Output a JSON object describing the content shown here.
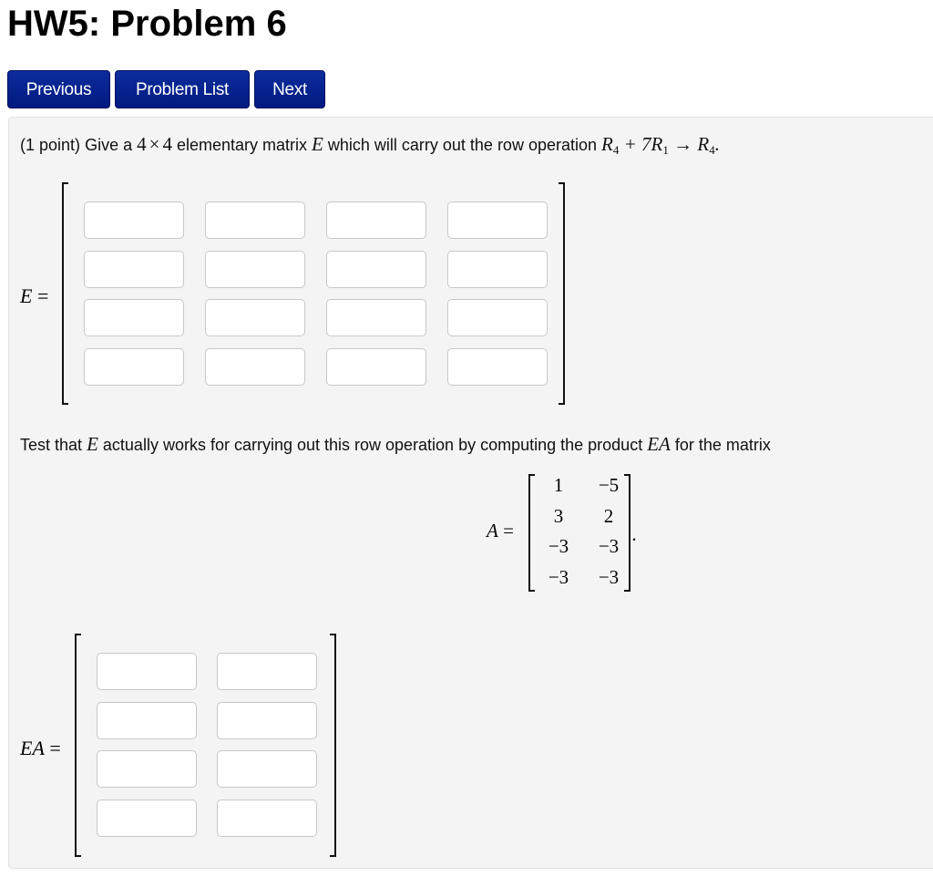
{
  "page": {
    "title": "HW5: Problem 6"
  },
  "nav": {
    "previous": "Previous",
    "problem_list": "Problem List",
    "next": "Next"
  },
  "problem": {
    "points": "(1 point)",
    "intro_text": "Give a",
    "dims_a": "4",
    "times": "×",
    "dims_b": "4",
    "intro_text2": "elementary matrix",
    "matrix_name": "E",
    "intro_text3": "which will carry out the row operation",
    "op": {
      "r4": "R",
      "r4_sub": "4",
      "plus": "+ 7",
      "r1": "R",
      "r1_sub": "1",
      "arrow": "→",
      "r4b": "R",
      "r4b_sub": "4",
      "period": "."
    },
    "e_label": "E =",
    "e_matrix": {
      "rows": 4,
      "cols": 4,
      "values": [
        [
          "",
          "",
          "",
          ""
        ],
        [
          "",
          "",
          "",
          ""
        ],
        [
          "",
          "",
          "",
          ""
        ],
        [
          "",
          "",
          "",
          ""
        ]
      ]
    },
    "test_text1": "Test that",
    "test_E": "E",
    "test_text2": "actually works for carrying out this row operation by computing the product",
    "test_EA": "EA",
    "test_text3": "for the matrix",
    "a_label": "A =",
    "a_matrix": [
      [
        "1",
        "−5"
      ],
      [
        "3",
        "2"
      ],
      [
        "−3",
        "−3"
      ],
      [
        "−3",
        "−3"
      ]
    ],
    "a_period": ".",
    "ea_label": "EA =",
    "ea_matrix": {
      "rows": 4,
      "cols": 2,
      "values": [
        [
          "",
          ""
        ],
        [
          "",
          ""
        ],
        [
          "",
          ""
        ],
        [
          "",
          ""
        ]
      ]
    }
  }
}
